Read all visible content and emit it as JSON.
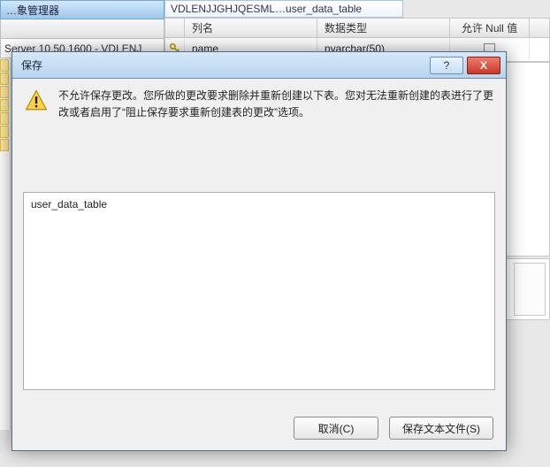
{
  "bg": {
    "titlebar": "…象管理器",
    "server": "Server 10.50.1600 - VDLENJ",
    "tab": "VDLENJJGHJQESML…user_data_table",
    "table": {
      "headers": {
        "col1": "列名",
        "col2": "数据类型",
        "col3": "允许 Null 值"
      },
      "row": {
        "name": "name",
        "type": "nvarchar(50)"
      }
    }
  },
  "dialog": {
    "title": "保存",
    "help_hint": "?",
    "close_hint": "X",
    "message": "不允许保存更改。您所做的更改要求删除并重新创建以下表。您对无法重新创建的表进行了更改或者启用了“阻止保存要求重新创建表的更改”选项。",
    "list_item": "user_data_table",
    "buttons": {
      "cancel": "取消(C)",
      "save_text": "保存文本文件(S)"
    }
  }
}
